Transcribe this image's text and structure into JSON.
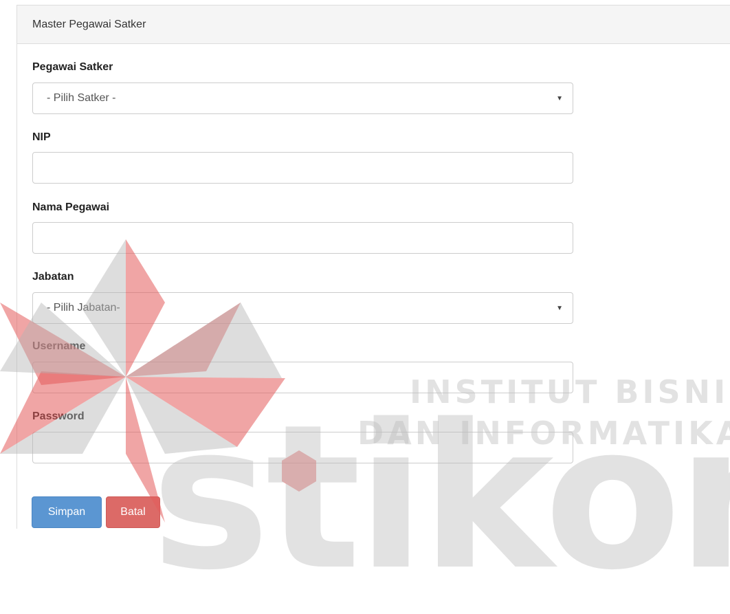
{
  "panel": {
    "title": "Master Pegawai Satker"
  },
  "form": {
    "satker": {
      "label": "Pegawai Satker",
      "selected": "- Pilih Satker -"
    },
    "nip": {
      "label": "NIP",
      "value": ""
    },
    "nama": {
      "label": "Nama Pegawai",
      "value": ""
    },
    "jabatan": {
      "label": "Jabatan",
      "selected": "- Pilih Jabatan-"
    },
    "username": {
      "label": "Username",
      "value": ""
    },
    "password": {
      "label": "Password",
      "value": ""
    }
  },
  "buttons": {
    "save_label": "Simpan",
    "cancel_label": "Batal"
  },
  "watermark": {
    "line1": "INSTITUT BISNIS",
    "line2": "DAN INFORMATIKA",
    "brand": "stikom"
  },
  "colors": {
    "save_button": "#5b96d2",
    "cancel_button": "#dc6a67",
    "logo_red": "#e35b5b",
    "logo_grey": "#bdbdbd"
  },
  "icons": {
    "select_caret": "caret-down-icon",
    "watermark_logo": "stikom-logo-icon"
  }
}
